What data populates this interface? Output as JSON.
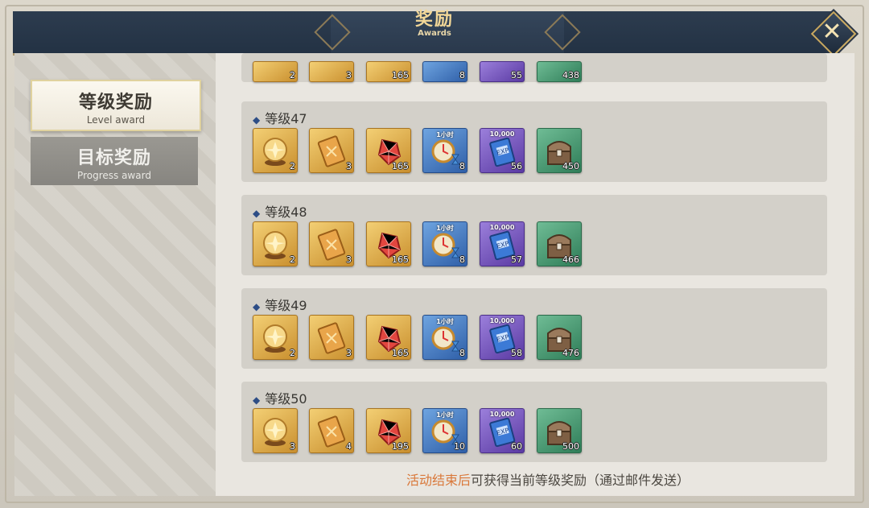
{
  "header": {
    "title": "奖励",
    "subtitle": "Awards",
    "close_glyph": "✕"
  },
  "tabs": [
    {
      "cn": "等级奖励",
      "en": "Level award",
      "active": true
    },
    {
      "cn": "目标奖励",
      "en": "Progress award",
      "active": false
    }
  ],
  "partial_row": {
    "quantities": [
      "2",
      "3",
      "165",
      "8",
      "55",
      "438"
    ]
  },
  "rows": [
    {
      "label": "等级47",
      "items": [
        {
          "icon": "crystal-orb-icon",
          "qty": "2"
        },
        {
          "icon": "scroll-card-icon",
          "qty": "3"
        },
        {
          "icon": "red-gem-icon",
          "qty": "165"
        },
        {
          "icon": "hourglass-clock-icon",
          "badge": "1小时",
          "qty": "8"
        },
        {
          "icon": "exp-book-icon",
          "badge": "10,000",
          "qty": "56"
        },
        {
          "icon": "treasure-chest-icon",
          "qty": "450"
        }
      ]
    },
    {
      "label": "等级48",
      "items": [
        {
          "icon": "crystal-orb-icon",
          "qty": "2"
        },
        {
          "icon": "scroll-card-icon",
          "qty": "3"
        },
        {
          "icon": "red-gem-icon",
          "qty": "165"
        },
        {
          "icon": "hourglass-clock-icon",
          "badge": "1小时",
          "qty": "8"
        },
        {
          "icon": "exp-book-icon",
          "badge": "10,000",
          "qty": "57"
        },
        {
          "icon": "treasure-chest-icon",
          "qty": "466"
        }
      ]
    },
    {
      "label": "等级49",
      "items": [
        {
          "icon": "crystal-orb-icon",
          "qty": "2"
        },
        {
          "icon": "scroll-card-icon",
          "qty": "3"
        },
        {
          "icon": "red-gem-icon",
          "qty": "165"
        },
        {
          "icon": "hourglass-clock-icon",
          "badge": "1小时",
          "qty": "8"
        },
        {
          "icon": "exp-book-icon",
          "badge": "10,000",
          "qty": "58"
        },
        {
          "icon": "treasure-chest-icon",
          "qty": "476"
        }
      ]
    },
    {
      "label": "等级50",
      "items": [
        {
          "icon": "crystal-orb-icon",
          "qty": "3"
        },
        {
          "icon": "scroll-card-icon",
          "qty": "4"
        },
        {
          "icon": "red-gem-icon",
          "qty": "195"
        },
        {
          "icon": "hourglass-clock-icon",
          "badge": "1小时",
          "qty": "10"
        },
        {
          "icon": "exp-book-icon",
          "badge": "10,000",
          "qty": "60"
        },
        {
          "icon": "treasure-chest-icon",
          "qty": "500"
        }
      ]
    }
  ],
  "footer": {
    "highlight": "活动结束后",
    "rest": "可获得当前等级奖励（通过邮件发送）"
  },
  "colors": {
    "header_bg": "#233244",
    "title_gold": "#f2d797",
    "highlight_orange": "#d9783a",
    "level_star": "#2d4d86"
  }
}
